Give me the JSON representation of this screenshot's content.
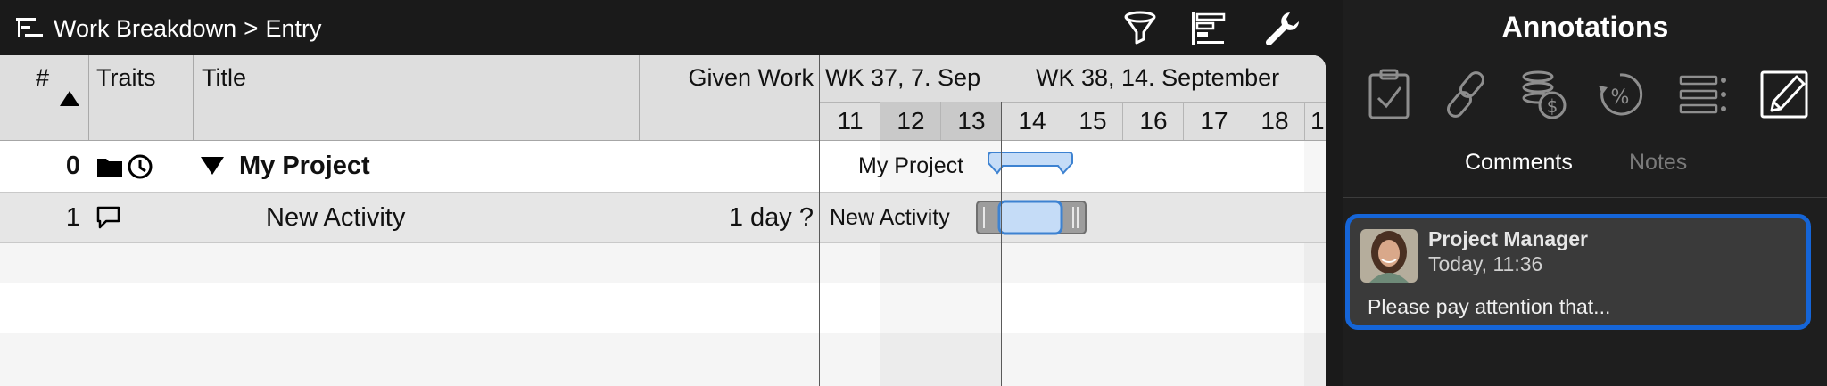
{
  "breadcrumb": {
    "section": "Work Breakdown",
    "separator": ">",
    "page": "Entry"
  },
  "toolbar": {
    "icons": [
      "filter-icon",
      "gantt-bars-icon",
      "wrench-icon"
    ]
  },
  "columns": {
    "number": "#",
    "traits": "Traits",
    "title": "Title",
    "given_work": "Given Work",
    "sort": "ascending"
  },
  "timeline": {
    "week1": "WK 37, 7. Sep",
    "week2": "WK 38, 14. September",
    "days": [
      "11",
      "12",
      "13",
      "14",
      "15",
      "16",
      "17",
      "18",
      "1"
    ],
    "weekend_days": [
      "12",
      "13"
    ]
  },
  "rows": [
    {
      "number": "0",
      "title": "My Project",
      "given_work": "",
      "bar_label": "My Project",
      "trait_icons": [
        "folder-icon",
        "clock-icon"
      ],
      "expanded": true
    },
    {
      "number": "1",
      "title": "New Activity",
      "given_work": "1 day ?",
      "bar_label": "New Activity",
      "trait_icons": [
        "comment-icon"
      ]
    }
  ],
  "sidebar": {
    "title": "Annotations",
    "icons": [
      "checklist-icon",
      "link-icon",
      "cost-icon",
      "percent-icon",
      "list-icon",
      "edit-icon"
    ],
    "tabs": {
      "comments": "Comments",
      "notes": "Notes",
      "active": "Comments"
    },
    "comment": {
      "author": "Project Manager",
      "time": "Today, 11:36",
      "text": "Please pay attention that..."
    }
  },
  "colors": {
    "accent": "#1565d8",
    "bar_fill": "#c5dcf7",
    "bar_stroke": "#3d82d1"
  }
}
